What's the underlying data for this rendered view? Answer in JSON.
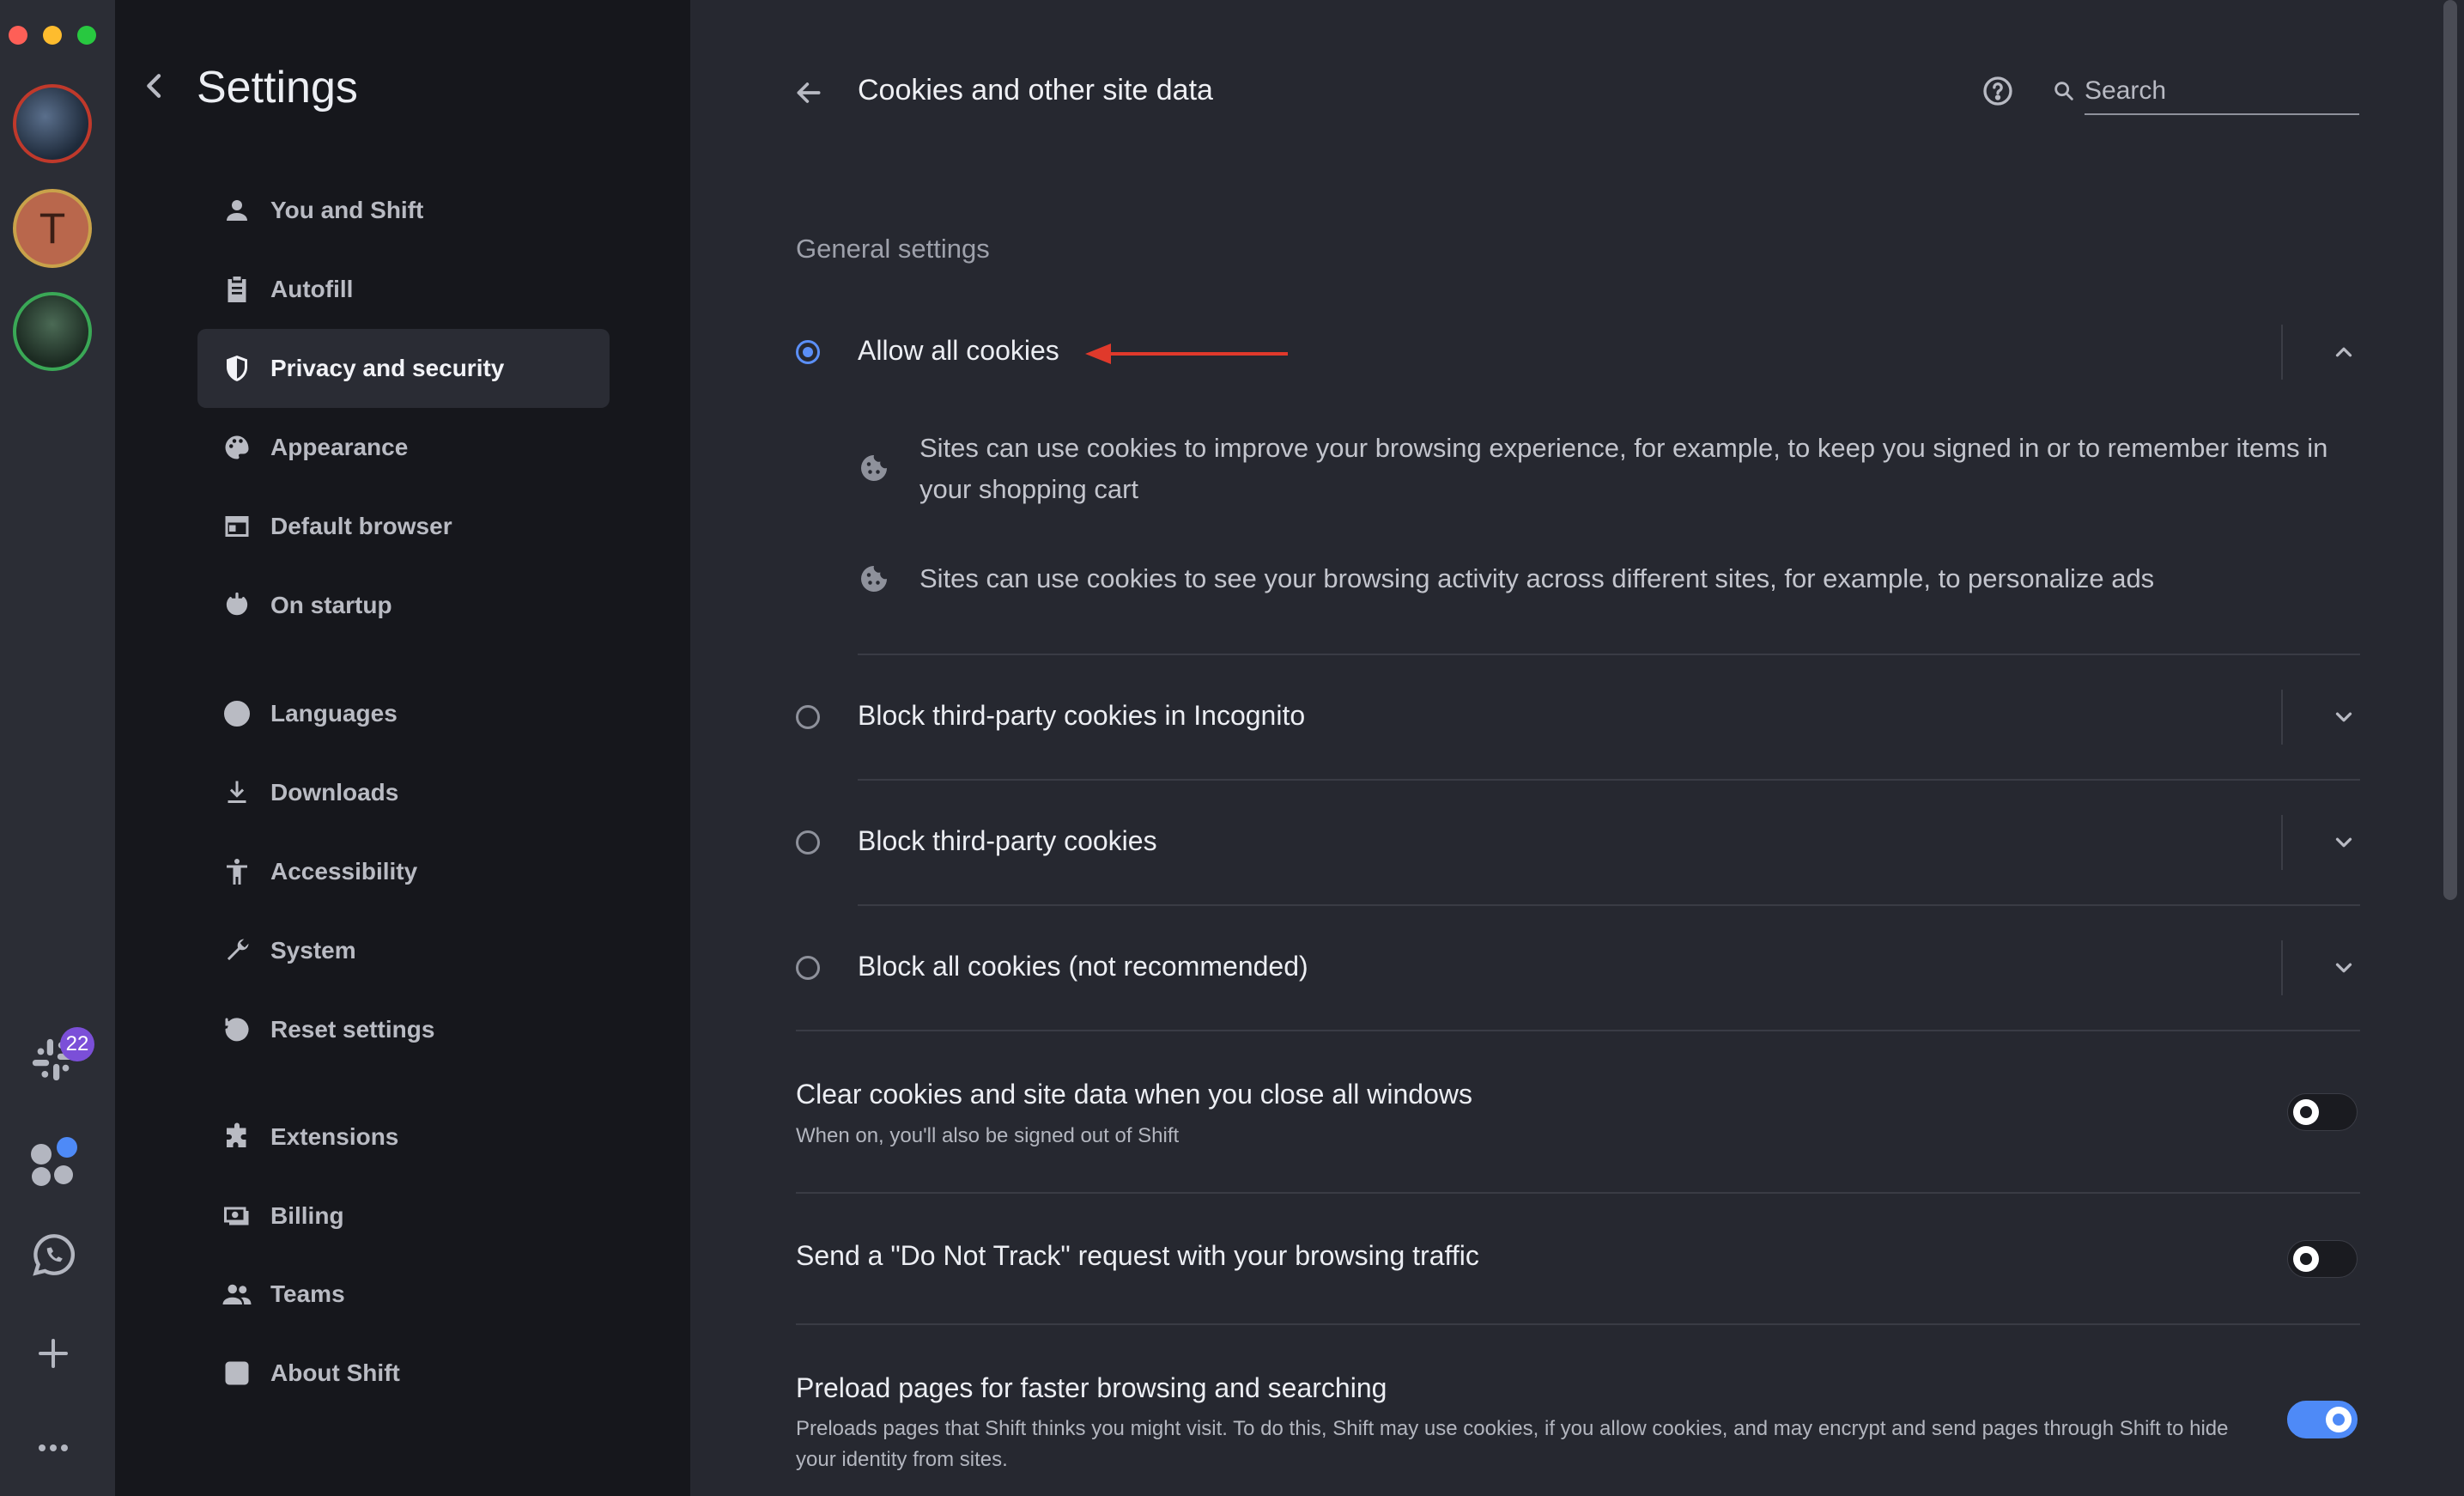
{
  "dock": {
    "avatar_letter": "T",
    "slack_badge": "22"
  },
  "sidebar": {
    "title": "Settings",
    "items": [
      {
        "label": "You and Shift",
        "icon": "person-icon"
      },
      {
        "label": "Autofill",
        "icon": "clipboard-icon"
      },
      {
        "label": "Privacy and security",
        "icon": "shield-icon",
        "active": true
      },
      {
        "label": "Appearance",
        "icon": "palette-icon"
      },
      {
        "label": "Default browser",
        "icon": "browser-window-icon"
      },
      {
        "label": "On startup",
        "icon": "power-icon"
      },
      {
        "label": "Languages",
        "icon": "globe-icon"
      },
      {
        "label": "Downloads",
        "icon": "download-icon"
      },
      {
        "label": "Accessibility",
        "icon": "accessibility-icon"
      },
      {
        "label": "System",
        "icon": "wrench-icon"
      },
      {
        "label": "Reset settings",
        "icon": "history-icon"
      },
      {
        "label": "Extensions",
        "icon": "puzzle-icon"
      },
      {
        "label": "Billing",
        "icon": "billing-icon"
      },
      {
        "label": "Teams",
        "icon": "group-icon"
      },
      {
        "label": "About Shift",
        "icon": "about-icon"
      }
    ]
  },
  "header": {
    "title": "Cookies and other site data",
    "search_placeholder": "Search"
  },
  "general": {
    "heading": "General settings",
    "options": [
      {
        "label": "Allow all cookies",
        "selected": true,
        "expanded": true
      },
      {
        "label": "Block third-party cookies in Incognito",
        "selected": false
      },
      {
        "label": "Block third-party cookies",
        "selected": false
      },
      {
        "label": "Block all cookies (not recommended)",
        "selected": false
      }
    ],
    "allow_desc": [
      "Sites can use cookies to improve your browsing experience, for example, to keep you signed in or to remember items in your shopping cart",
      "Sites can use cookies to see your browsing activity across different sites, for example, to personalize ads"
    ]
  },
  "toggles": [
    {
      "title": "Clear cookies and site data when you close all windows",
      "subtitle": "When on, you'll also be signed out of Shift",
      "on": false
    },
    {
      "title": "Send a \"Do Not Track\" request with your browsing traffic",
      "subtitle": "",
      "on": false
    },
    {
      "title": "Preload pages for faster browsing and searching",
      "subtitle": "Preloads pages that Shift thinks you might visit. To do this, Shift may use cookies, if you allow cookies, and may encrypt and send pages through Shift to hide your identity from sites.",
      "on": true
    }
  ],
  "colors": {
    "accent": "#4e8af7",
    "annotation_arrow": "#e0392b"
  }
}
